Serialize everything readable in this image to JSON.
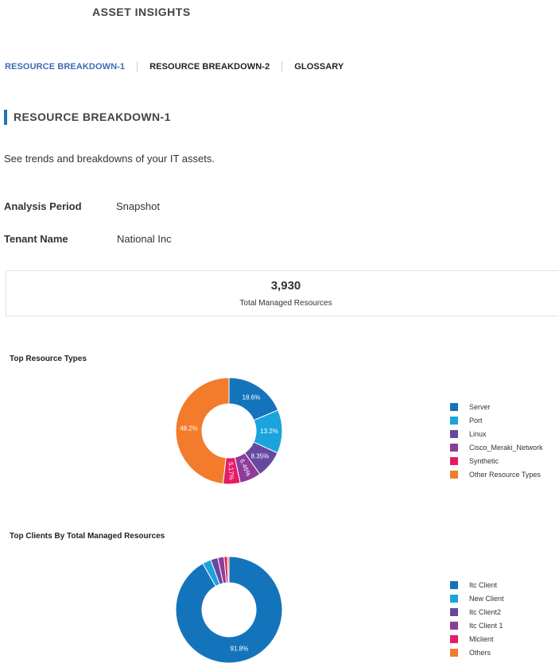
{
  "app": {
    "title": "ASSET INSIGHTS"
  },
  "tabs": [
    {
      "label": "RESOURCE BREAKDOWN-1",
      "active": true
    },
    {
      "label": "RESOURCE BREAKDOWN-2",
      "active": false
    },
    {
      "label": "GLOSSARY",
      "active": false
    }
  ],
  "section": {
    "title": "RESOURCE BREAKDOWN-1",
    "description": "See trends and breakdowns of your IT assets."
  },
  "info": {
    "analysis_period_label": "Analysis Period",
    "analysis_period_value": "Snapshot",
    "tenant_name_label": "Tenant Name",
    "tenant_name_value": "National Inc"
  },
  "kpi": {
    "value": "3,930",
    "label": "Total Managed Resources"
  },
  "colors": {
    "accent": "#1b75bb",
    "active_tab": "#3f6cb5"
  },
  "chart_data": [
    {
      "type": "pie",
      "variant": "donut",
      "title": "Top Resource Types",
      "legend_position": "right",
      "categories": [
        "Server",
        "Port",
        "Linux",
        "Cisco_Meraki_Network",
        "Synthetic",
        "Other Resource Types"
      ],
      "values": [
        18.6,
        13.2,
        8.35,
        6.46,
        5.17,
        48.2
      ],
      "labels": [
        "18.6%",
        "13.2%",
        "8.35%",
        "6.46%",
        "5.17%",
        "48.2%"
      ],
      "colors": [
        "#1474bb",
        "#1ba3de",
        "#6549a0",
        "#8e3c9b",
        "#e71a66",
        "#f27c2b"
      ]
    },
    {
      "type": "pie",
      "variant": "donut",
      "title": "Top Clients By Total Managed Resources",
      "legend_position": "right",
      "categories": [
        "Itc Client",
        "New Client",
        "Itc Client2",
        "Itc Client 1",
        "Mlclient",
        "Others"
      ],
      "values": [
        91.8,
        2.6,
        2.2,
        1.9,
        1.0,
        0.5
      ],
      "labels": [
        "91.8%",
        "",
        "",
        "",
        "",
        ""
      ],
      "colors": [
        "#1474bb",
        "#1ba3de",
        "#6549a0",
        "#8e3c9b",
        "#e71a66",
        "#f27c2b"
      ]
    }
  ]
}
